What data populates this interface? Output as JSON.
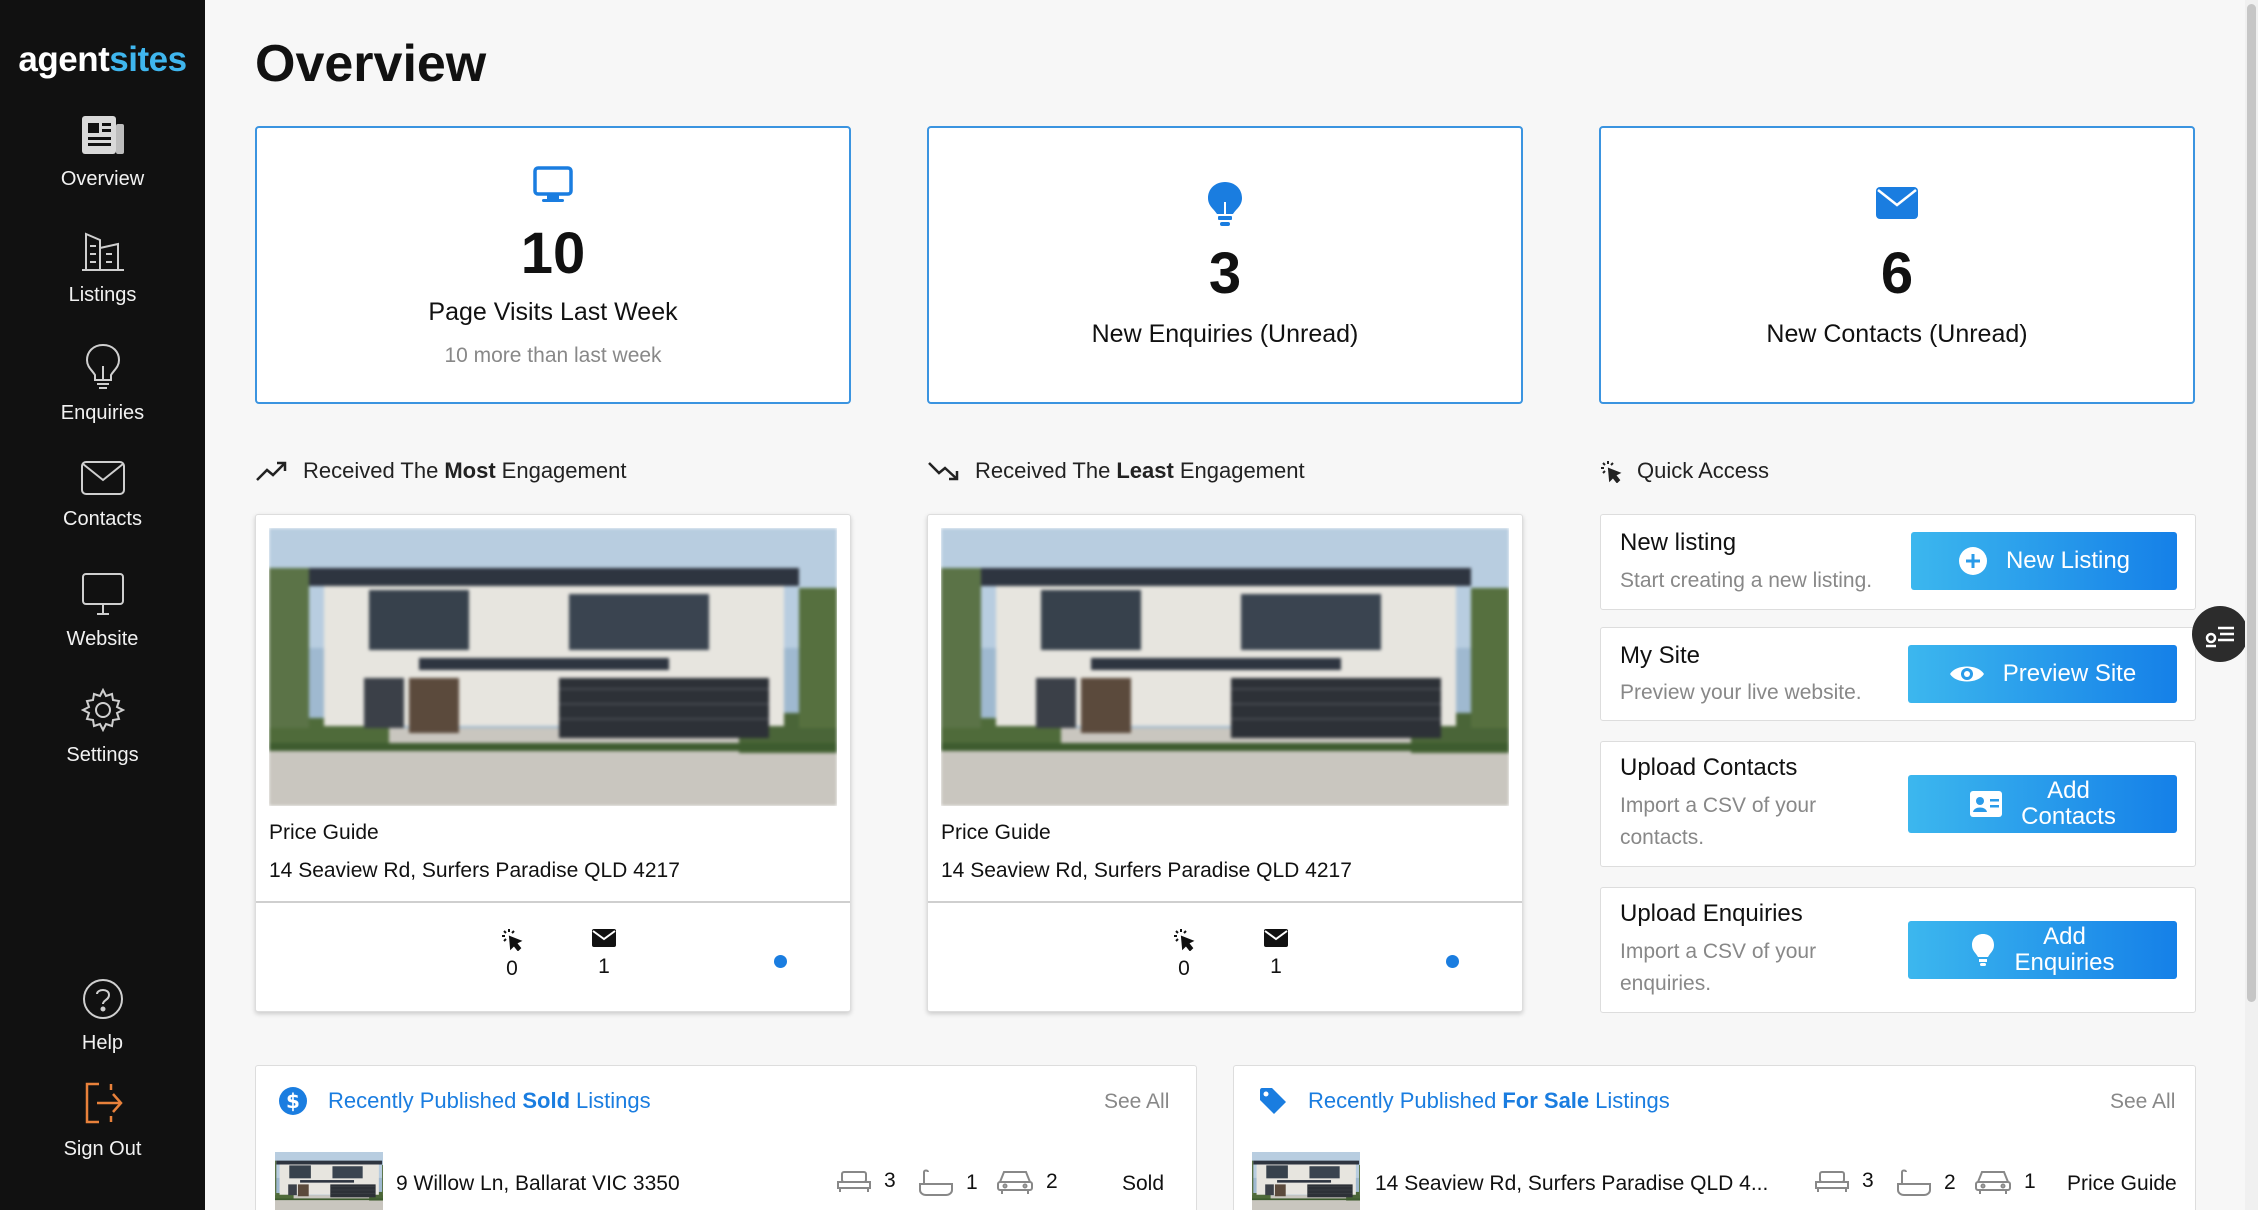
{
  "brand": {
    "part1": "agent",
    "part2": "sites"
  },
  "sidebar": {
    "items": [
      {
        "label": "Overview"
      },
      {
        "label": "Listings"
      },
      {
        "label": "Enquiries"
      },
      {
        "label": "Contacts"
      },
      {
        "label": "Website"
      },
      {
        "label": "Settings"
      }
    ],
    "help": "Help",
    "signout": "Sign Out"
  },
  "page": {
    "title": "Overview"
  },
  "stats": [
    {
      "icon": "monitor-icon",
      "value": "10",
      "label": "Page Visits Last Week",
      "sub": "10 more than last week"
    },
    {
      "icon": "lightbulb-icon",
      "value": "3",
      "label": "New Enquiries (Unread)"
    },
    {
      "icon": "envelope-icon",
      "value": "6",
      "label": "New Contacts (Unread)"
    }
  ],
  "engagement": {
    "most": {
      "prefix": "Received The",
      "bold": "Most",
      "suffix": "Engagement"
    },
    "least": {
      "prefix": "Received The",
      "bold": "Least",
      "suffix": "Engagement"
    },
    "listings": [
      {
        "price": "Price Guide",
        "address": "14 Seaview Rd, Surfers Paradise QLD 4217",
        "clicks": "0",
        "enquiries": "1"
      },
      {
        "price": "Price Guide",
        "address": "14 Seaview Rd, Surfers Paradise QLD 4217",
        "clicks": "0",
        "enquiries": "1"
      }
    ]
  },
  "quick_access": {
    "title": "Quick Access",
    "items": [
      {
        "title": "New listing",
        "desc": "Start creating a new listing.",
        "button": "New Listing"
      },
      {
        "title": "My Site",
        "desc": "Preview your live website.",
        "button": "Preview Site"
      },
      {
        "title": "Upload Contacts",
        "desc1": "Import a CSV of your",
        "desc2": "contacts.",
        "button1": "Add",
        "button2": "Contacts"
      },
      {
        "title": "Upload Enquiries",
        "desc1": "Import a CSV of your",
        "desc2": "enquiries.",
        "button1": "Add",
        "button2": "Enquiries"
      }
    ]
  },
  "sold": {
    "prefix": "Recently Published",
    "bold": "Sold",
    "suffix": "Listings",
    "see_all": "See All",
    "row": {
      "address": "9 Willow Ln, Ballarat VIC 3350",
      "beds": "3",
      "baths": "1",
      "cars": "2",
      "status": "Sold"
    }
  },
  "for_sale": {
    "prefix": "Recently Published",
    "bold": "For Sale",
    "suffix": "Listings",
    "see_all": "See All",
    "row": {
      "address": "14 Seaview Rd, Surfers Paradise QLD 4...",
      "beds": "3",
      "baths": "2",
      "cars": "1",
      "status": "Price Guide"
    }
  },
  "colors": {
    "sidebar_bg": "#111111",
    "accent": "#1a7de0",
    "brand_light": "#3fb6ee",
    "card_border": "#3b94e0"
  }
}
